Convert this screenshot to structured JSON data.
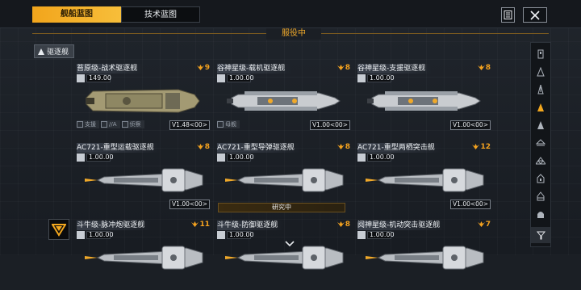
{
  "tabs": [
    {
      "label": "舰船蓝图",
      "active": true
    },
    {
      "label": "技术蓝图",
      "active": false
    }
  ],
  "section": {
    "title": "服役中"
  },
  "filter": {
    "label": "驱逐舰"
  },
  "research_bar": {
    "label": "研究中"
  },
  "colors": {
    "accent": "#f2a51c"
  },
  "cards": [
    {
      "name": "苔原级-战术驱逐舰",
      "stars": "9",
      "stat": "149.00",
      "roles": [
        "支援",
        "//A",
        "侦察"
      ],
      "version": "V1.48<00>"
    },
    {
      "name": "谷神星级-载机驱逐舰",
      "stars": "8",
      "stat": "1.00.00",
      "roles": [
        "母舰"
      ],
      "version": "V1.00<00>"
    },
    {
      "name": "谷神星级-支援驱逐舰",
      "stars": "8",
      "stat": "1.00.00",
      "roles": [],
      "version": "V1.00<00>"
    },
    {
      "name": "AC721-重型运载驱逐舰",
      "stars": "8",
      "stat": "1.00.00",
      "roles": [],
      "version": "V1.00<00>"
    },
    {
      "name": "AC721-重型导弹驱逐舰",
      "stars": "8",
      "stat": "1.00.00",
      "roles": [],
      "version": ""
    },
    {
      "name": "AC721-重型两栖突击舰",
      "stars": "12",
      "stat": "1.00.00",
      "roles": [],
      "version": "V1.00<00>"
    },
    {
      "name": "斗牛级-脉冲炮驱逐舰",
      "stars": "11",
      "stat": "1.00.00",
      "roles": [],
      "version": ""
    },
    {
      "name": "斗牛级-防御驱逐舰",
      "stars": "8",
      "stat": "1.00.00",
      "roles": [],
      "version": ""
    },
    {
      "name": "阋神星级-机动突击驱逐舰",
      "stars": "7",
      "stat": "1.00.00",
      "roles": [],
      "version": ""
    }
  ]
}
